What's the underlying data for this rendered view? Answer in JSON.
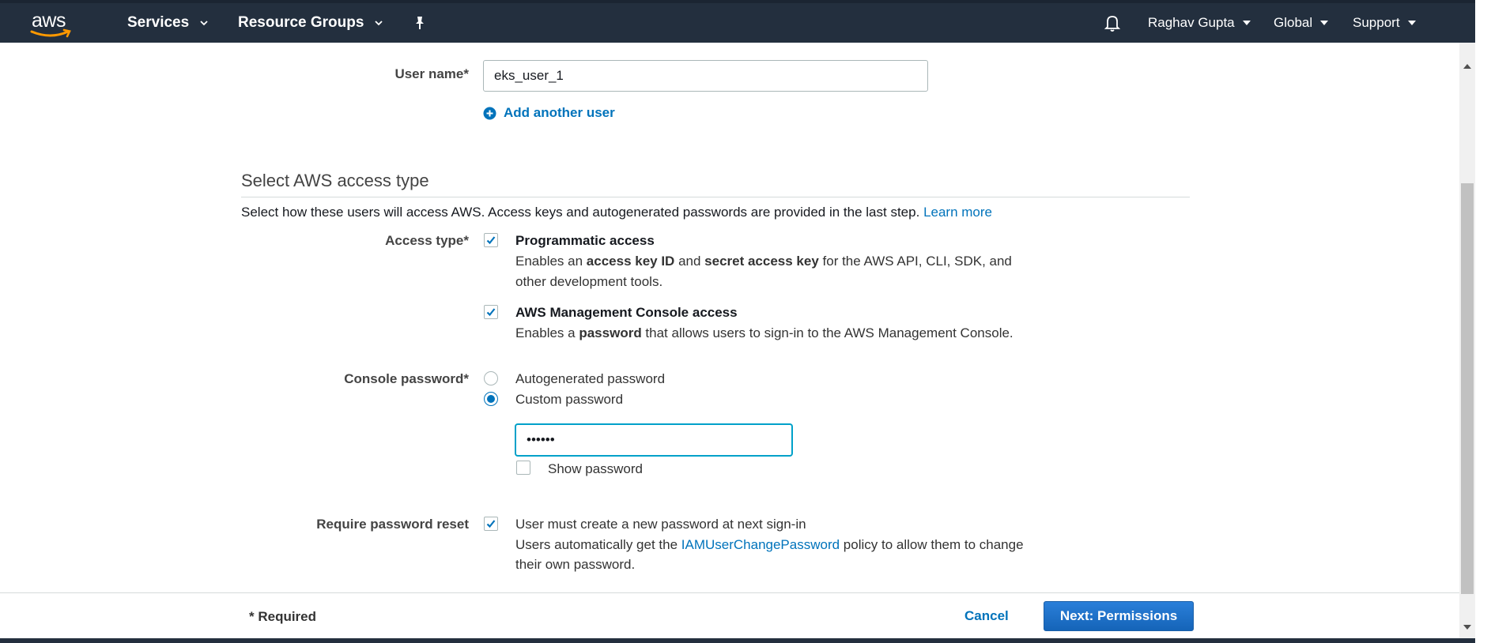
{
  "nav": {
    "logo_text": "aws",
    "services": "Services",
    "resource_groups": "Resource Groups",
    "user": "Raghav Gupta",
    "region": "Global",
    "support": "Support"
  },
  "form": {
    "user_name_label": "User name*",
    "user_name_value": "eks_user_1",
    "add_another_user": "Add another user",
    "section_title": "Select AWS access type",
    "section_desc": "Select how these users will access AWS. Access keys and autogenerated passwords are provided in the last step.",
    "learn_more": "Learn more",
    "access_type_label": "Access type*",
    "programmatic": {
      "title": "Programmatic access",
      "desc_1": "Enables an ",
      "desc_b1": "access key ID",
      "desc_2": " and ",
      "desc_b2": "secret access key",
      "desc_3": " for the AWS API, CLI, SDK, and",
      "desc_line2": "other development tools.",
      "checked": true
    },
    "console_access": {
      "title": "AWS Management Console access",
      "desc_1": "Enables a ",
      "desc_b1": "password",
      "desc_2": " that allows users to sign-in to the AWS Management Console.",
      "checked": true
    },
    "console_password_label": "Console password*",
    "autogenerated": "Autogenerated password",
    "custom": "Custom password",
    "password_value": "••••••",
    "show_password": "Show password",
    "require_reset_label": "Require password reset",
    "require_reset_text": "User must create a new password at next sign-in",
    "reset_desc_1": "Users automatically get the ",
    "reset_policy_link": "IAMUserChangePassword",
    "reset_desc_2": " policy to allow them to change",
    "reset_desc_line2": "their own password."
  },
  "footer": {
    "required": "* Required",
    "cancel": "Cancel",
    "next": "Next: Permissions"
  },
  "colors": {
    "nav_bg": "#232f3e",
    "link": "#0073bb",
    "primary_button": "#1e6fc7"
  }
}
